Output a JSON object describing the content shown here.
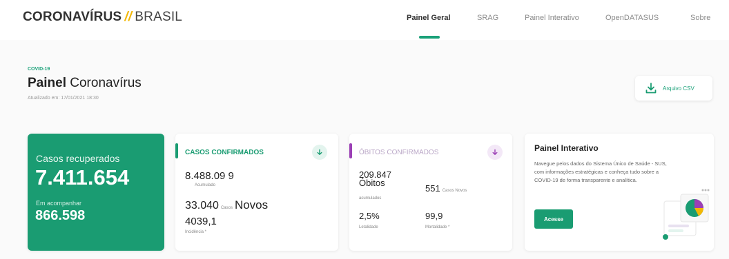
{
  "header": {
    "brand_main": "CORONAVÍRUS",
    "brand_slash": "//",
    "brand_country": "BRASIL",
    "nav": [
      {
        "label": "Painel Geral",
        "active": true
      },
      {
        "label": "SRAG",
        "active": false
      },
      {
        "label": "Painel Interativo",
        "active": false
      },
      {
        "label": "OpenDATASUS",
        "active": false
      },
      {
        "label": "Sobre",
        "active": false
      }
    ]
  },
  "page": {
    "eyebrow": "COVID-19",
    "title_bold": "Painel",
    "title_rest": "Coronavírus",
    "updated": "Atualizado em: 17/01/2021 18:30",
    "csv_button": "Arquivo CSV"
  },
  "recovered": {
    "label": "Casos recuperados",
    "value": "7.411.654",
    "sub_label": "Em acompanhar",
    "sub_value": "866.598"
  },
  "confirmed": {
    "title": "CASOS CONFIRMADOS",
    "total": "8.488.09 9",
    "total_label": "Acumulado",
    "new_value": "33.040",
    "new_unit": "Casos",
    "new_label": "Novos",
    "incidence_value": "4039,1",
    "incidence_label": "Incidência *"
  },
  "deaths": {
    "title": "ÓBITOS CONFIRMADOS",
    "total": "209.847 Óbitos",
    "total_label": "acumulados",
    "new_value": "551",
    "new_unit": "Casos Novos",
    "lethality_value": "2,5%",
    "lethality_label": "Letalidade",
    "mortality_value": "99,9",
    "mortality_label": "Mortalidade *"
  },
  "interactive": {
    "title": "Painel Interativo",
    "description": "Navegue pelos dados do Sistema Único de Saúde - SUS, com informações estratégicas e conheça tudo sobre a COVID-19 de forma transparente e analítica.",
    "button": "Acesse"
  },
  "colors": {
    "green": "#1a9c72",
    "purple": "#9b3fb5",
    "yellow": "#f2b705"
  },
  "icons": {
    "csv": "download-icon",
    "confirmed_toggle": "arrow-down-icon",
    "deaths_toggle": "arrow-down-icon"
  }
}
